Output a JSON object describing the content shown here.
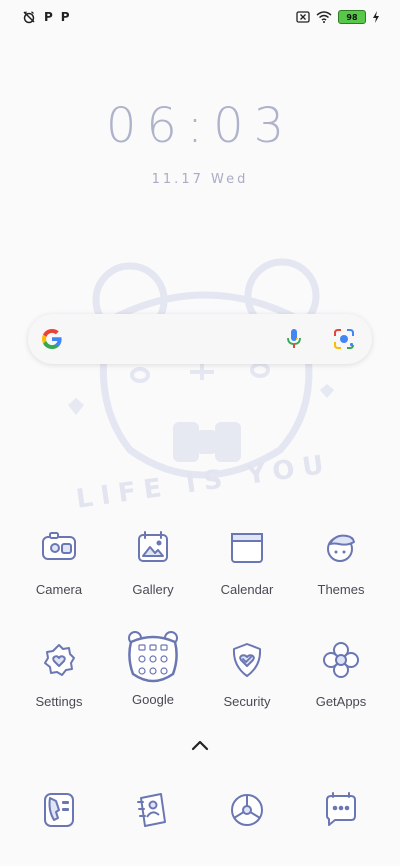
{
  "status_bar": {
    "left_icons": [
      "alarm-off-icon",
      "parking-icon",
      "parking-icon"
    ],
    "left_letters": [
      "P",
      "P"
    ],
    "right_icons": [
      "no-sim-icon",
      "wifi-icon",
      "battery-icon",
      "charging-icon"
    ],
    "battery_level": "98",
    "battery_color": "#58c84a"
  },
  "clock": {
    "time": "06:03",
    "date": "11.17 Wed"
  },
  "search_bar": {
    "icons": [
      "google-g-icon",
      "microphone-icon",
      "google-lens-icon"
    ]
  },
  "wallpaper": {
    "text": "LIFE IS YOU"
  },
  "apps_row1": [
    {
      "label": "Camera",
      "icon": "camera-icon"
    },
    {
      "label": "Gallery",
      "icon": "gallery-icon"
    },
    {
      "label": "Calendar",
      "icon": "calendar-icon"
    },
    {
      "label": "Themes",
      "icon": "themes-icon"
    }
  ],
  "apps_row2": [
    {
      "label": "Settings",
      "icon": "settings-icon"
    },
    {
      "label": "Google",
      "icon": "google-folder-icon"
    },
    {
      "label": "Security",
      "icon": "security-icon"
    },
    {
      "label": "GetApps",
      "icon": "getapps-icon"
    }
  ],
  "app_drawer": {
    "icon": "chevron-up-icon"
  },
  "dock": [
    {
      "icon": "phone-icon"
    },
    {
      "icon": "contacts-icon"
    },
    {
      "icon": "browser-icon"
    },
    {
      "icon": "messages-icon"
    }
  ],
  "colors": {
    "icon_stroke": "#6b77b3",
    "icon_fill": "#dfe4f6",
    "clock_text": "#aeb2ca"
  }
}
